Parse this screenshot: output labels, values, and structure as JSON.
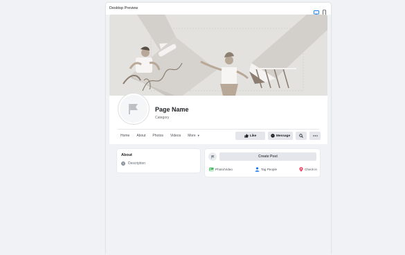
{
  "window": {
    "title": "Desktop Preview",
    "device_icons": [
      "desktop-icon",
      "mobile-icon"
    ]
  },
  "page": {
    "name": "Page Name",
    "category": "Category"
  },
  "tabs": [
    {
      "label": "Home"
    },
    {
      "label": "About"
    },
    {
      "label": "Photos"
    },
    {
      "label": "Videos"
    },
    {
      "label": "More"
    }
  ],
  "actions": {
    "like": "Like",
    "message": "Message"
  },
  "about": {
    "title": "About",
    "description": "Description"
  },
  "composer": {
    "create_post": "Create Post",
    "photo_video": "Photo/Video",
    "tag_people": "Tag People",
    "check_in": "Check in"
  },
  "colors": {
    "accent": "#1877f2",
    "cover_bg": "#e4e2df",
    "photo_green": "#45bd62",
    "check_in_red": "#f3425f"
  }
}
